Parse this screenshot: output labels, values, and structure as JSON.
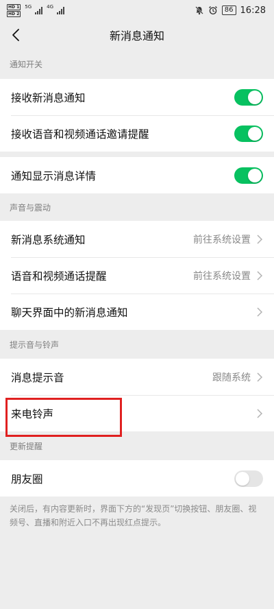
{
  "status_bar": {
    "sim1": "HD 1",
    "sim2": "HD 2",
    "net1": "5G",
    "net2": "4G",
    "battery": "86",
    "time": "16:28"
  },
  "nav": {
    "title": "新消息通知"
  },
  "sections": {
    "notify_switch": {
      "header": "通知开关",
      "receive_new": "接收新消息通知",
      "voice_video_invite": "接收语音和视频通话邀请提醒",
      "show_details": "通知显示消息详情"
    },
    "sound_vibration": {
      "header": "声音与震动",
      "new_msg_system": "新消息系统通知",
      "new_msg_system_value": "前往系统设置",
      "voice_video_remind": "语音和视频通话提醒",
      "voice_video_remind_value": "前往系统设置",
      "chat_new_msg": "聊天界面中的新消息通知"
    },
    "tone_ring": {
      "header": "提示音与铃声",
      "msg_tone": "消息提示音",
      "msg_tone_value": "跟随系统",
      "ringtone": "来电铃声"
    },
    "update_remind": {
      "header": "更新提醒",
      "moments": "朋友圈",
      "note": "关闭后，有内容更新时，界面下方的“发现页”切换按钮、朋友圈、视频号、直播和附近入口不再出现红点提示。"
    }
  },
  "toggles": {
    "receive_new": true,
    "voice_video_invite": true,
    "show_details": true,
    "moments": false
  },
  "colors": {
    "toggle_on": "#07c160",
    "toggle_off": "#e5e5e5",
    "highlight": "#e02020",
    "background": "#ededed"
  },
  "icons": {
    "back": "chevron-left-icon",
    "row_arrow": "chevron-right-icon",
    "mute": "bell-off-icon",
    "alarm": "alarm-icon"
  }
}
